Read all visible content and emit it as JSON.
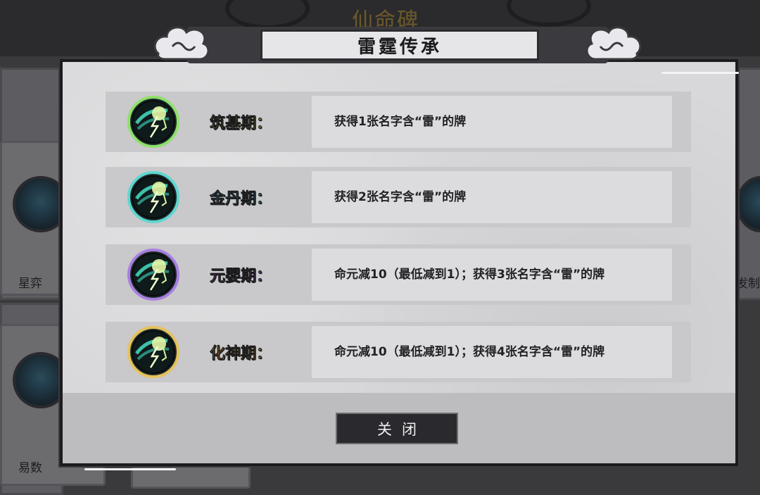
{
  "background": {
    "title": "仙命碑",
    "left_labels": [
      "星弈",
      "易数"
    ],
    "right_labels": [
      "发制"
    ]
  },
  "dialog": {
    "title": "雷霆传承",
    "rows": [
      {
        "stage": "筑基期：",
        "stage_color": "#a6e04a",
        "ring_color": "#8ee06a",
        "description": "获得1张名字含“雷”的牌"
      },
      {
        "stage": "金丹期：",
        "stage_color": "#2f9ee8",
        "ring_color": "#5fd6d0",
        "description": "获得2张名字含“雷”的牌"
      },
      {
        "stage": "元婴期：",
        "stage_color": "#a24bd8",
        "ring_color": "#a87fe0",
        "description": "命元减10（最低减到1）；获得3张名字含“雷”的牌"
      },
      {
        "stage": "化神期：",
        "stage_color": "#e9962c",
        "ring_color": "#e6c259",
        "description": "命元减10（最低减到1）；获得4张名字含“雷”的牌"
      }
    ],
    "close_label": "关闭",
    "icon_name": "thunder-inheritance-icon"
  }
}
